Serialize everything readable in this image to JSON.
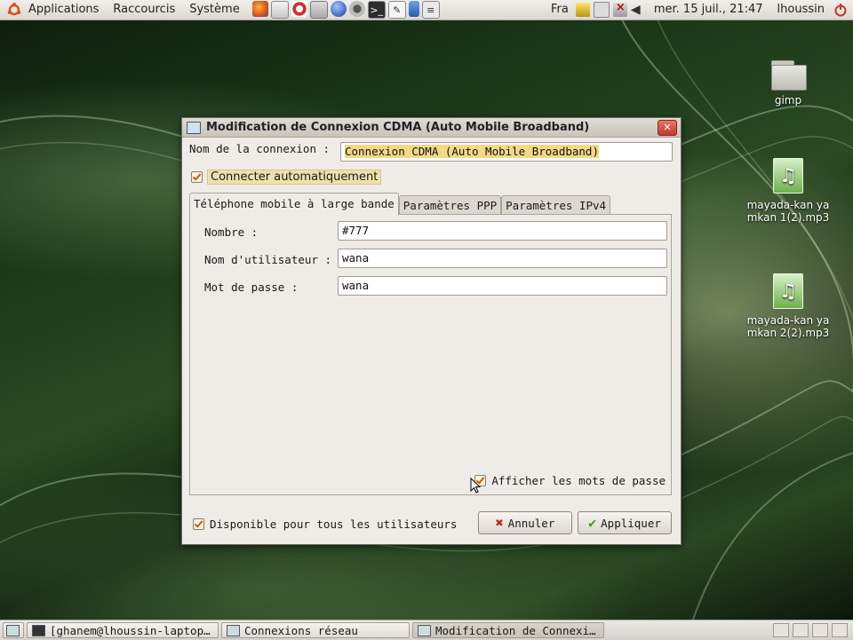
{
  "top_panel": {
    "menus": [
      "Applications",
      "Raccourcis",
      "Système"
    ],
    "launchers": [
      "firefox-icon",
      "mail-icon",
      "help-icon",
      "files-icon",
      "globe-icon",
      "users-icon",
      "terminal-icon",
      "editor-icon",
      "phone-icon",
      "text-editor-icon"
    ],
    "keyboard_layout": "Fra",
    "datetime": "mer. 15 juil., 21:47",
    "user": "lhoussin"
  },
  "desktop_icons": [
    {
      "label": "gimp",
      "icon": "folder-icon"
    },
    {
      "label": "mayada-kan ya mkan 1(2).mp3",
      "icon": "audio-file-icon"
    },
    {
      "label": "mayada-kan ya mkan 2(2).mp3",
      "icon": "audio-file-icon"
    }
  ],
  "dialog": {
    "title": "Modification de Connexion CDMA (Auto Mobile Broadband)",
    "name_label": "Nom de la connexion :",
    "name_value": "Connexion CDMA (Auto Mobile Broadband)",
    "auto_connect_label": "Connecter automatiquement",
    "auto_connect_checked": true,
    "tabs": [
      "Téléphone mobile à large bande",
      "Paramètres PPP",
      "Paramètres IPv4"
    ],
    "active_tab": 0,
    "fields": [
      {
        "label": "Nombre :",
        "value": "#777"
      },
      {
        "label": "Nom d'utilisateur :",
        "value": "wana"
      },
      {
        "label": "Mot de passe :",
        "value": "wana"
      }
    ],
    "show_passwords_label": "Afficher les mots de passe",
    "show_passwords_checked": true,
    "all_users_label": "Disponible pour tous les utilisateurs",
    "all_users_checked": true,
    "cancel_label": "Annuler",
    "apply_label": "Appliquer"
  },
  "taskbar": {
    "tasks": [
      {
        "label": "[ghanem@lhoussin-laptop…",
        "active": false
      },
      {
        "label": "Connexions réseau",
        "active": false
      },
      {
        "label": "Modification de Connexi…",
        "active": true
      }
    ]
  }
}
